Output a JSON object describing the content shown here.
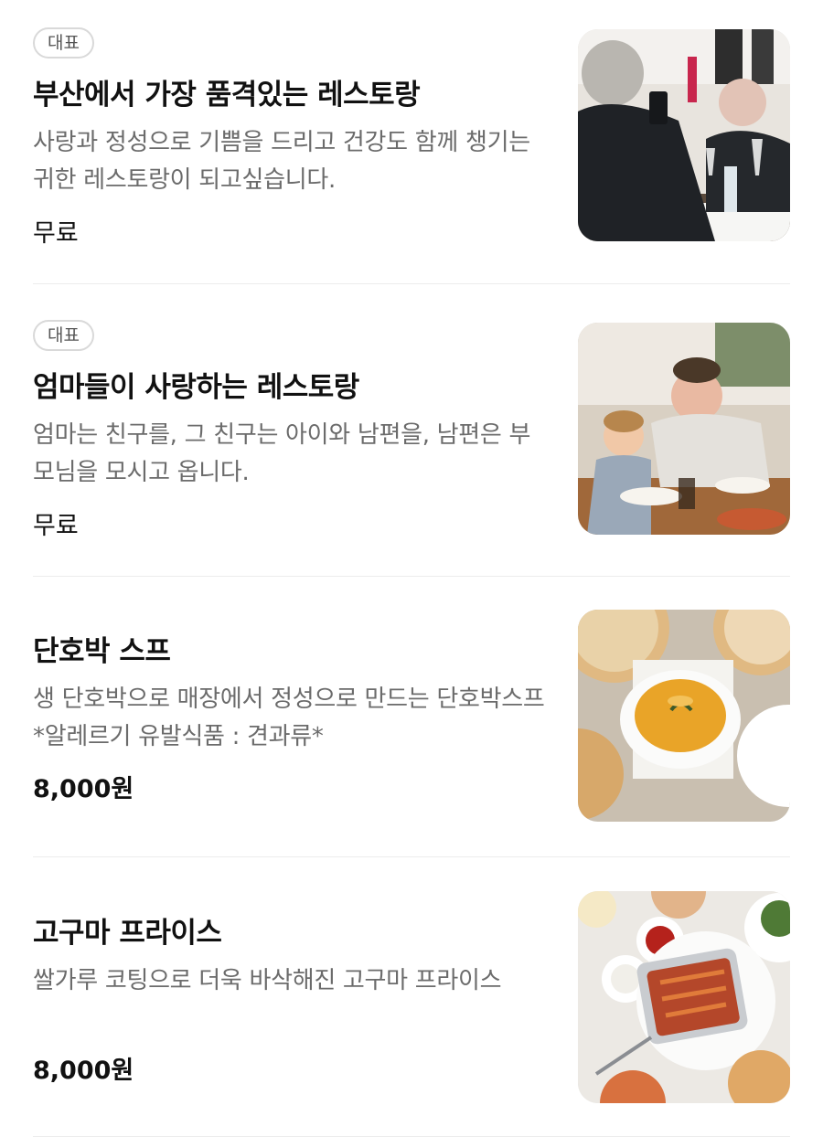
{
  "items": [
    {
      "badge": "대표",
      "title": "부산에서 가장 품격있는 레스토랑",
      "description": "사랑과 정성으로 기쁨을 드리고 건강도 함께 챙기는 귀한 레스토랑이 되고싶습니다.",
      "price": "무료",
      "image_icon": "restaurant-diners-photo"
    },
    {
      "badge": "대표",
      "title": "엄마들이 사랑하는 레스토랑",
      "description": "엄마는 친구를, 그 친구는 아이와 남편을, 남편은 부모님을 모시고 옵니다.",
      "price": "무료",
      "image_icon": "family-dining-photo"
    },
    {
      "badge": "",
      "title": "단호박 스프",
      "description": "생 단호박으로 매장에서 정성으로 만드는 단호박스프 *알레르기 유발식품 : 견과류*",
      "price": "8,000원",
      "image_icon": "pumpkin-soup-photo"
    },
    {
      "badge": "",
      "title": "고구마 프라이스",
      "description": "쌀가루 코팅으로 더욱 바삭해진 고구마 프라이스",
      "price": "8,000원",
      "image_icon": "sweet-potato-fries-photo"
    }
  ]
}
